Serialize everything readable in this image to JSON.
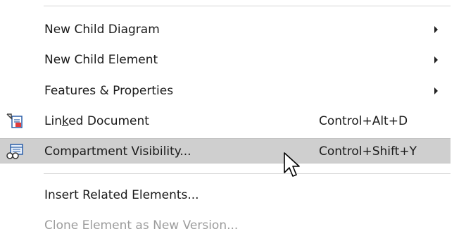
{
  "menu": {
    "items": [
      {
        "label": "New Child Diagram",
        "submenu": true
      },
      {
        "label": "New Child Element",
        "submenu": true
      },
      {
        "label": "Features & Properties",
        "submenu": true
      },
      {
        "label_pre": "Lin",
        "label_ul": "k",
        "label_post": "ed Document",
        "shortcut": "Control+Alt+D",
        "icon": "linked-document-icon"
      },
      {
        "label": "Compartment Visibility...",
        "shortcut": "Control+Shift+Y",
        "icon": "compartment-visibility-icon",
        "highlighted": true
      },
      {
        "label": "Insert Related Elements..."
      },
      {
        "label": "Clone Element as New Version...",
        "disabled": true
      }
    ]
  },
  "colors": {
    "highlight": "#cfcfcf",
    "disabled_text": "#9c9c9c",
    "separator": "#d4d4d4"
  }
}
